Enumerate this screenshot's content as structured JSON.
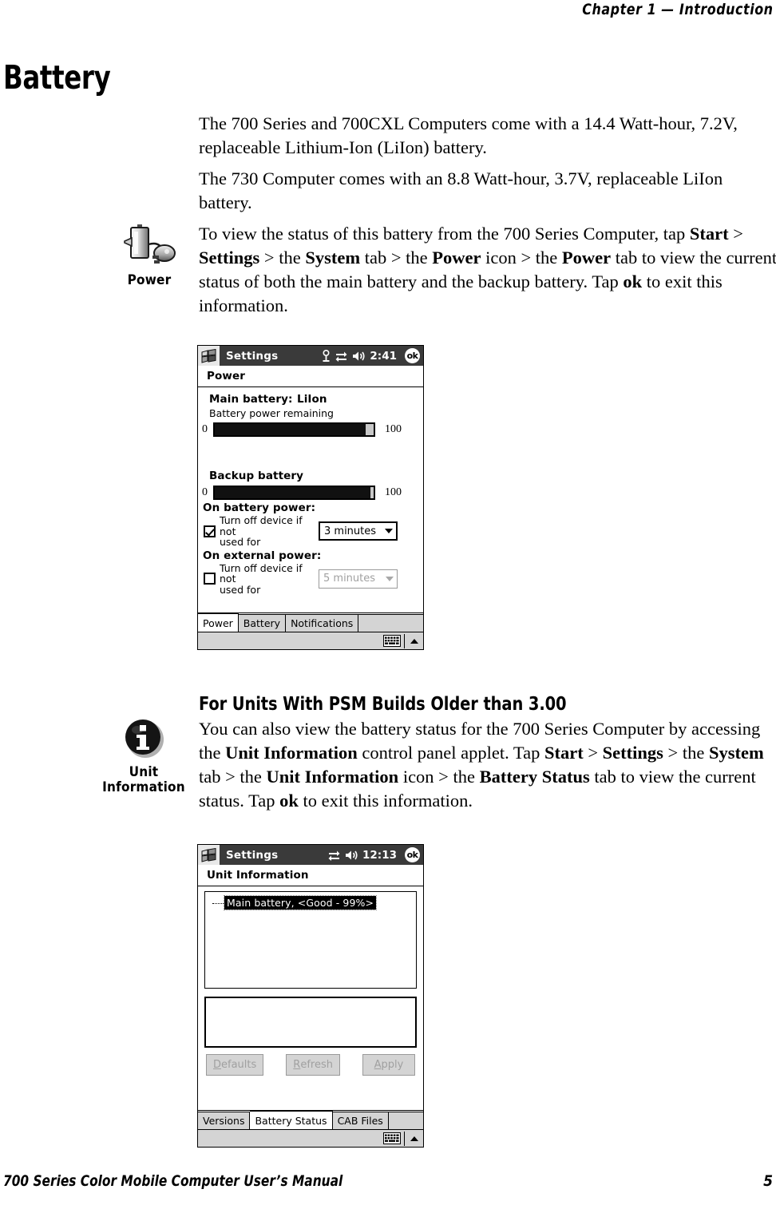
{
  "header": {
    "chapter_text": "Chapter 1 — Introduction"
  },
  "heading": {
    "h1": "Battery",
    "h3": "For Units With PSM Builds Older than 3.00"
  },
  "paragraphs": {
    "p1": "The 700 Series and 700CXL Computers come with a 14.4 Watt-hour, 7.2V, replaceable Lithium-Ion (LiIon) battery.",
    "p2": "The 730 Computer comes with an 8.8 Watt-hour, 3.7V, replaceable LiIon battery.",
    "p3_a": "To view the status of this battery from the 700 Series Computer, tap ",
    "p3_b_start": "Start",
    "p3_c": " > ",
    "p3_b_settings": "Settings",
    "p3_d": " > the ",
    "p3_b_system": "System",
    "p3_e": " tab > the ",
    "p3_b_power1": "Power",
    "p3_f": " icon > the ",
    "p3_b_power2": "Power",
    "p3_g": " tab to view the current status of both the main battery and the backup battery. Tap ",
    "p3_b_ok": "ok",
    "p3_h": " to exit this information.",
    "p4_a": "You can also view the battery status for the 700 Series Computer by accessing the ",
    "p4_b_unitinfo1": "Unit Information",
    "p4_b": " control panel applet. Tap ",
    "p4_b_start": "Start",
    "p4_c": " > ",
    "p4_b_settings": "Settings",
    "p4_d": " > the ",
    "p4_b_system": "System",
    "p4_e": " tab > the ",
    "p4_b_unitinfo2": "Unit Information",
    "p4_f": " icon > the ",
    "p4_b_battstatus": "Battery Status",
    "p4_g": " tab to view the current status. Tap ",
    "p4_b_ok": "ok",
    "p4_h": " to exit this information."
  },
  "margin_icons": {
    "power": {
      "caption": "Power",
      "icon": "power-plug-battery-icon"
    },
    "unit_information": {
      "caption_line1": "Unit",
      "caption_line2": "Information",
      "icon": "info-circle-icon"
    }
  },
  "screenshot_power": {
    "titlebar": {
      "start_icon": "windows-flag-icon",
      "title": "Settings",
      "icons": [
        "antenna-icon",
        "sync-arrows-icon",
        "speaker-icon"
      ],
      "time": "2:41",
      "ok_label": "ok"
    },
    "applet_title": "Power",
    "main_battery_label": "Main battery:",
    "main_battery_type": "LiIon",
    "battery_power_remaining": "Battery power remaining",
    "main_gauge": {
      "min": "0",
      "max": "100",
      "percent": 95
    },
    "backup_battery_label": "Backup battery",
    "backup_gauge": {
      "min": "0",
      "max": "100",
      "percent": 98
    },
    "on_battery_power_label": "On battery power:",
    "on_battery_checkbox": {
      "checked": true,
      "label_line1": "Turn off device if not",
      "label_line2": "used for"
    },
    "on_battery_combo": {
      "value": "3 minutes",
      "disabled": false
    },
    "on_external_power_label": "On external power:",
    "on_external_checkbox": {
      "checked": false,
      "label_line1": "Turn off device if not",
      "label_line2": "used for"
    },
    "on_external_combo": {
      "value": "5 minutes",
      "disabled": true
    },
    "tabs": [
      {
        "label": "Power",
        "active": true
      },
      {
        "label": "Battery",
        "active": false
      },
      {
        "label": "Notifications",
        "active": false
      }
    ],
    "footer": {
      "keyboard_icon": "soft-keyboard-icon",
      "arrow_icon": "up-arrow-icon"
    }
  },
  "screenshot_unitinfo": {
    "titlebar": {
      "start_icon": "windows-flag-icon",
      "title": "Settings",
      "icons": [
        "sync-arrows-icon",
        "speaker-icon"
      ],
      "time": "12:13",
      "ok_label": "ok"
    },
    "applet_title": "Unit Information",
    "tree_item": "Main battery, <Good - 99%>",
    "buttons": [
      {
        "accel": "D",
        "rest": "efaults",
        "disabled": true
      },
      {
        "accel": "R",
        "rest": "efresh",
        "disabled": true
      },
      {
        "accel": "A",
        "rest": "pply",
        "disabled": true
      }
    ],
    "tabs": [
      {
        "label": "Versions",
        "active": false
      },
      {
        "label": "Battery Status",
        "active": true
      },
      {
        "label": "CAB Files",
        "active": false
      }
    ],
    "footer": {
      "keyboard_icon": "soft-keyboard-icon",
      "arrow_icon": "up-arrow-icon"
    }
  },
  "footer": {
    "manual_title": "700 Series Color Mobile Computer User’s Manual",
    "page_number": "5"
  }
}
